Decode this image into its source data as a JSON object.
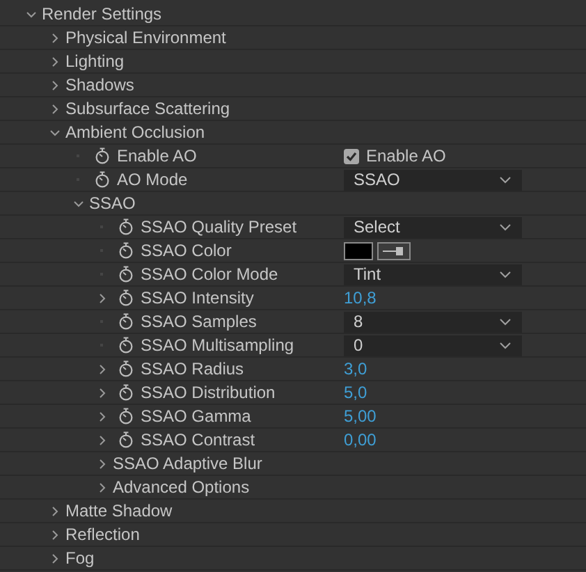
{
  "tree": [
    {
      "kind": "group",
      "label": "Render Settings",
      "expanded": true,
      "children": [
        {
          "kind": "group",
          "label": "Physical Environment",
          "expanded": false
        },
        {
          "kind": "group",
          "label": "Lighting",
          "expanded": false
        },
        {
          "kind": "group",
          "label": "Shadows",
          "expanded": false
        },
        {
          "kind": "group",
          "label": "Subsurface Scattering",
          "expanded": false
        },
        {
          "kind": "group",
          "label": "Ambient Occlusion",
          "expanded": true,
          "children": [
            {
              "kind": "property",
              "label": "Enable AO",
              "control": {
                "kind": "checkbox",
                "checked": true,
                "label": "Enable AO"
              }
            },
            {
              "kind": "property",
              "label": "AO Mode",
              "control": {
                "kind": "dropdown",
                "value": "SSAO"
              }
            },
            {
              "kind": "group",
              "label": "SSAO",
              "expanded": true,
              "children": [
                {
                  "kind": "property",
                  "label": "SSAO Quality Preset",
                  "control": {
                    "kind": "dropdown",
                    "value": "Select"
                  }
                },
                {
                  "kind": "property",
                  "label": "SSAO Color",
                  "control": {
                    "kind": "color",
                    "color": "#000000"
                  }
                },
                {
                  "kind": "property",
                  "label": "SSAO Color Mode",
                  "control": {
                    "kind": "dropdown",
                    "value": "Tint"
                  }
                },
                {
                  "kind": "property",
                  "label": "SSAO Intensity",
                  "expanded": false,
                  "control": {
                    "kind": "number",
                    "value": "10,8"
                  }
                },
                {
                  "kind": "property",
                  "label": "SSAO Samples",
                  "control": {
                    "kind": "dropdown",
                    "value": "8"
                  }
                },
                {
                  "kind": "property",
                  "label": "SSAO Multisampling",
                  "control": {
                    "kind": "dropdown",
                    "value": "0"
                  }
                },
                {
                  "kind": "property",
                  "label": "SSAO Radius",
                  "expanded": false,
                  "control": {
                    "kind": "number",
                    "value": "3,0"
                  }
                },
                {
                  "kind": "property",
                  "label": "SSAO Distribution",
                  "expanded": false,
                  "control": {
                    "kind": "number",
                    "value": "5,0"
                  }
                },
                {
                  "kind": "property",
                  "label": "SSAO Gamma",
                  "expanded": false,
                  "control": {
                    "kind": "number",
                    "value": "5,00"
                  }
                },
                {
                  "kind": "property",
                  "label": "SSAO Contrast",
                  "expanded": false,
                  "control": {
                    "kind": "number",
                    "value": "0,00"
                  }
                },
                {
                  "kind": "group",
                  "label": "SSAO Adaptive Blur",
                  "expanded": false
                },
                {
                  "kind": "group",
                  "label": "Advanced Options",
                  "expanded": false
                }
              ]
            }
          ]
        },
        {
          "kind": "group",
          "label": "Matte Shadow",
          "expanded": false
        },
        {
          "kind": "group",
          "label": "Reflection",
          "expanded": false
        },
        {
          "kind": "group",
          "label": "Fog",
          "expanded": false
        }
      ]
    }
  ]
}
